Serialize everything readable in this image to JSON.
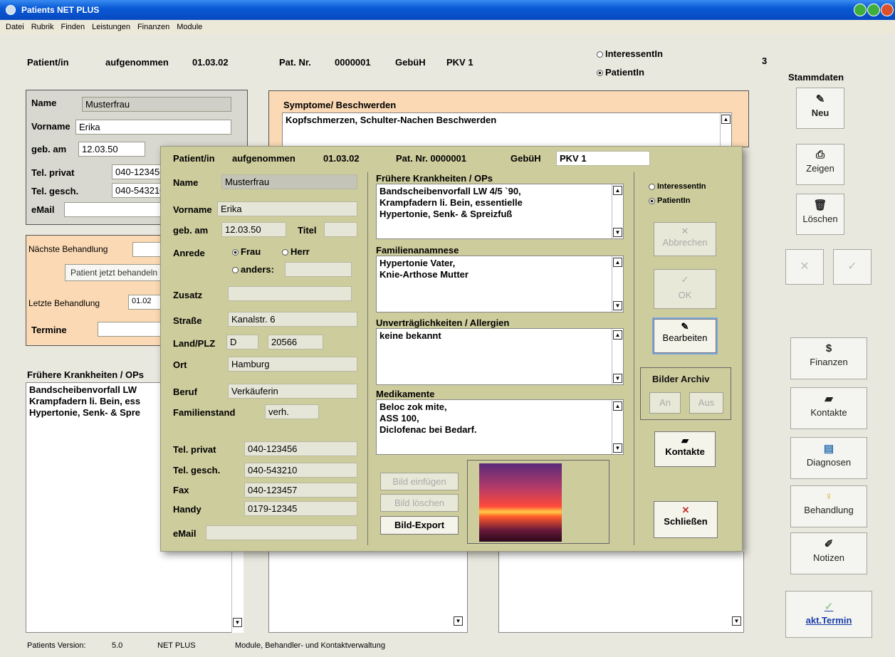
{
  "window": {
    "title": "Patients NET PLUS"
  },
  "menu": [
    "Datei",
    "Rubrik",
    "Finden",
    "Leistungen",
    "Finanzen",
    "Module"
  ],
  "header": {
    "patient_label": "Patient/in",
    "aufgenommen_label": "aufgenommen",
    "aufgenommen_value": "01.03.02",
    "patnr_label": "Pat. Nr.",
    "patnr_value": "0000001",
    "gebueh_label": "GebüH",
    "gebueh_value": "PKV 1",
    "radio_interessent": "InteressentIn",
    "radio_patient": "PatientIn",
    "count": "3"
  },
  "person": {
    "name_label": "Name",
    "name": "Musterfrau",
    "vorname_label": "Vorname",
    "vorname": "Erika",
    "geb_label": "geb. am",
    "geb": "12.03.50",
    "titel_label": "Titel",
    "telp_label": "Tel. privat",
    "telp": "040-123456",
    "telg_label": "Tel. gesch.",
    "telg": "040-543210",
    "email_label": "eMail"
  },
  "behandlung": {
    "naechste_label": "Nächste Behandlung",
    "jetzt_btn": "Patient jetzt behandeln",
    "letzte_label": "Letzte Behandlung",
    "letzte_value": "01.02",
    "termine_label": "Termine"
  },
  "symptome": {
    "label": "Symptome/ Beschwerden",
    "text": "Kopfschmerzen, Schulter-Nachen Beschwerden"
  },
  "frueher_bg": {
    "label": "Frühere Krankheiten / OPs",
    "lines": [
      "Bandscheibenvorfall LW",
      "Krampfadern li. Bein, ess",
      "Hypertonie, Senk- & Spre"
    ]
  },
  "stammdaten": {
    "title": "Stammdaten",
    "neu": "Neu",
    "zeigen": "Zeigen",
    "loeschen": "Löschen",
    "finanzen": "Finanzen",
    "kontakte": "Kontakte",
    "diagnosen": "Diagnosen",
    "behandlung": "Behandlung",
    "notizen": "Notizen",
    "termin": "akt.Termin"
  },
  "dialog": {
    "patient_label": "Patient/in",
    "aufgenommen_label": "aufgenommen",
    "aufgenommen_value": "01.03.02",
    "patnr": "Pat. Nr. 0000001",
    "gebueh_label": "GebüH",
    "gebueh_value": "PKV 1",
    "name_label": "Name",
    "name": "Musterfrau",
    "vorname_label": "Vorname",
    "vorname": "Erika",
    "geb_label": "geb. am",
    "geb": "12.03.50",
    "titel_label": "Titel",
    "anrede_label": "Anrede",
    "frau": "Frau",
    "herr": "Herr",
    "anders": "anders:",
    "zusatz_label": "Zusatz",
    "strasse_label": "Straße",
    "strasse": "Kanalstr. 6",
    "land_label": "Land/PLZ",
    "land": "D",
    "plz": "20566",
    "ort_label": "Ort",
    "ort": "Hamburg",
    "beruf_label": "Beruf",
    "beruf": "Verkäuferin",
    "familienstand_label": "Familienstand",
    "familienstand": "verh.",
    "telp_label": "Tel. privat",
    "telp": "040-123456",
    "telg_label": "Tel. gesch.",
    "telg": "040-543210",
    "fax_label": "Fax",
    "fax": "040-123457",
    "handy_label": "Handy",
    "handy": "0179-12345",
    "email_label": "eMail",
    "frueher_label": "Frühere Krankheiten / OPs",
    "frueher_lines": [
      "Bandscheibenvorfall LW 4/5 `90,",
      "Krampfadern li. Bein, essentielle",
      "Hypertonie, Senk- & Spreizfuß"
    ],
    "familien_label": "Familienanamnese",
    "familien_lines": [
      "Hypertonie Vater,",
      "Knie-Arthose Mutter"
    ],
    "allergie_label": "Unverträglichkeiten / Allergien",
    "allergie_lines": [
      "keine bekannt"
    ],
    "medi_label": "Medikamente",
    "medi_lines": [
      "Beloc zok mite,",
      "ASS 100,",
      "Diclofenac bei Bedarf."
    ],
    "bild_einfuegen": "Bild einfügen",
    "bild_loeschen": "Bild löschen",
    "bild_export": "Bild-Export",
    "radio_interessent": "InteressentIn",
    "radio_patient": "PatientIn",
    "abbrechen": "Abbrechen",
    "ok": "OK",
    "bearbeiten": "Bearbeiten",
    "archiv_title": "Bilder Archiv",
    "an": "An",
    "aus": "Aus",
    "kontakte": "Kontakte",
    "schliessen": "Schließen"
  },
  "status": {
    "version_label": "Patients Version:",
    "version": "5.0",
    "edition": "NET PLUS",
    "module": "Module, Behandler- und Kontaktverwaltung"
  }
}
